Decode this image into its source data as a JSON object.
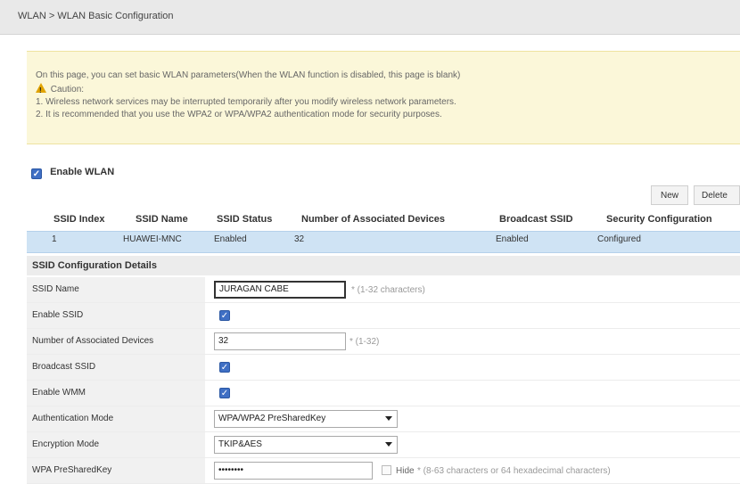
{
  "breadcrumb": "WLAN > WLAN Basic Configuration",
  "notice": {
    "line1": "On this page, you can set basic WLAN parameters(When the WLAN function is disabled, this page is blank)",
    "caution": "Caution:",
    "line2": "1. Wireless network services may be interrupted temporarily after you modify wireless network parameters.",
    "line3": "2. It is recommended that you use the WPA2 or WPA/WPA2 authentication mode for security purposes."
  },
  "enable_wlan": {
    "label": "Enable WLAN",
    "checked": true
  },
  "buttons": {
    "new": "New",
    "delete": "Delete"
  },
  "table": {
    "headers": [
      "SSID Index",
      "SSID Name",
      "SSID Status",
      "Number of Associated Devices",
      "Broadcast SSID",
      "Security Configuration"
    ],
    "rows": [
      [
        "1",
        "HUAWEI-MNC",
        "Enabled",
        "32",
        "Enabled",
        "Configured"
      ]
    ]
  },
  "details": {
    "title": "SSID Configuration Details",
    "ssid_name": {
      "label": "SSID Name",
      "value": "JURAGAN CABE",
      "hint": "* (1-32 characters)"
    },
    "enable_ssid": {
      "label": "Enable SSID",
      "checked": true
    },
    "num_devices": {
      "label": "Number of Associated Devices",
      "value": "32",
      "hint": "* (1-32)"
    },
    "broadcast_ssid": {
      "label": "Broadcast SSID",
      "checked": true
    },
    "enable_wmm": {
      "label": "Enable WMM",
      "checked": true
    },
    "auth_mode": {
      "label": "Authentication Mode",
      "value": "WPA/WPA2 PreSharedKey"
    },
    "encryption_mode": {
      "label": "Encryption Mode",
      "value": "TKIP&AES"
    },
    "psk": {
      "label": "WPA PreSharedKey",
      "value": "••••••••",
      "hide_label": "Hide",
      "hint": "* (8-63 characters or 64 hexadecimal characters)"
    }
  },
  "colors": {
    "accent": "#3f6fc4",
    "selected_row": "#cfe3f4",
    "notice_bg": "#fbf7d9"
  },
  "icons": {
    "caution": "warning-icon",
    "checkbox": "checkbox-checked-icon",
    "dropdown": "chevron-down-icon"
  }
}
